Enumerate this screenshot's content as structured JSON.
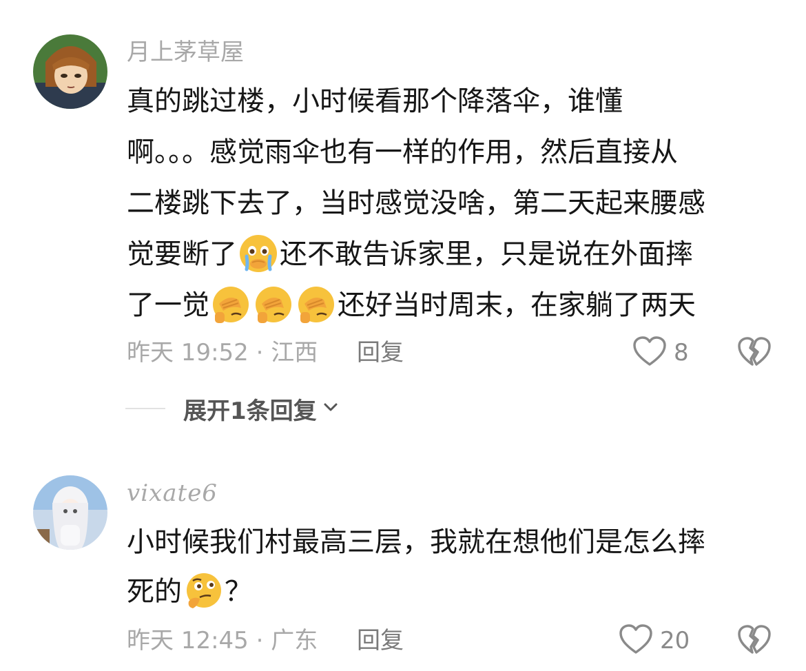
{
  "comments": [
    {
      "username": "月上茅草屋",
      "lines": [
        [
          "真的跳过楼，小时候看那个降落伞，谁懂"
        ],
        [
          "啊。。。感觉雨伞也有一样的作用，然后直接从"
        ],
        [
          "二楼跳下去了，当时感觉没啥，第二天起来腰感"
        ],
        [
          "觉要断了",
          "还不敢告诉家里，只是说在外面摔"
        ],
        [
          "了一觉",
          "还好当时周末，在家躺了两天"
        ]
      ],
      "emoji_names": [
        "crying-face-emoji",
        "facepalm-emoji"
      ],
      "time_location": "昨天 19:52 · 江西",
      "reply_label": "回复",
      "likes": "8",
      "expand_label": "展开1条回复"
    },
    {
      "username": "vixate6",
      "lines": [
        [
          "小时候我们村最高三层，我就在想他们是怎么摔"
        ],
        [
          "死的",
          "？"
        ]
      ],
      "emoji_names": [
        "thinking-face-emoji"
      ],
      "time_location": "昨天 12:45 · 广东",
      "reply_label": "回复",
      "likes": "20"
    }
  ],
  "colors": {
    "text": "#161616",
    "secondary": "#a8a8a8",
    "reply": "#7a7a7a",
    "emoji_yellow": "#f7c23c"
  }
}
